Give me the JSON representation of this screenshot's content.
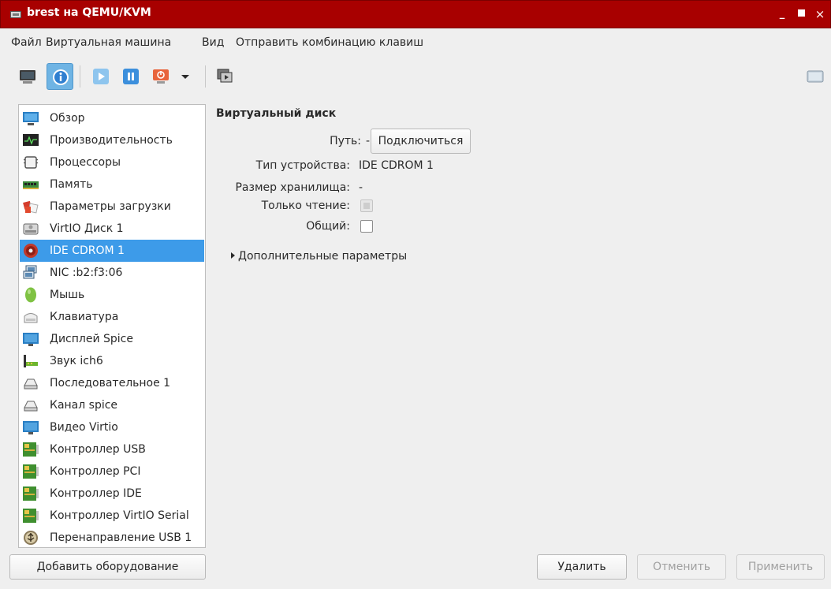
{
  "window": {
    "title": "brest на QEMU/KVM",
    "minimize": "_",
    "close": "×"
  },
  "menu": [
    "Файл",
    "Виртуальная машина",
    "Вид",
    "Отправить комбинацию клавиш"
  ],
  "toolbar": {
    "buttons": [
      "console-icon",
      "info-icon",
      "play-icon",
      "pause-icon",
      "power-icon",
      "dropdown-arrow-icon",
      "snapshot-icon",
      "fullscreen-icon"
    ],
    "active": "info-icon"
  },
  "sidebar": {
    "items": [
      {
        "label": "Обзор",
        "icon": "monitor-icon"
      },
      {
        "label": "Производительность",
        "icon": "performance-icon"
      },
      {
        "label": "Процессоры",
        "icon": "cpu-icon"
      },
      {
        "label": "Память",
        "icon": "memory-icon"
      },
      {
        "label": "Параметры загрузки",
        "icon": "boot-options-icon"
      },
      {
        "label": "VirtIO Диск 1",
        "icon": "disk-icon"
      },
      {
        "label": "IDE CDROM 1",
        "icon": "cdrom-icon"
      },
      {
        "label": "NIC :b2:f3:06",
        "icon": "network-icon"
      },
      {
        "label": "Мышь",
        "icon": "mouse-icon"
      },
      {
        "label": "Клавиатура",
        "icon": "keyboard-icon"
      },
      {
        "label": "Дисплей Spice",
        "icon": "display-icon"
      },
      {
        "label": "Звук ich6",
        "icon": "sound-icon"
      },
      {
        "label": "Последовательное 1",
        "icon": "serial-icon"
      },
      {
        "label": "Канал spice",
        "icon": "channel-icon"
      },
      {
        "label": "Видео Virtio",
        "icon": "video-icon"
      },
      {
        "label": "Контроллер USB",
        "icon": "controller-icon"
      },
      {
        "label": "Контроллер PCI",
        "icon": "controller-icon"
      },
      {
        "label": "Контроллер IDE",
        "icon": "controller-icon"
      },
      {
        "label": "Контроллер VirtIO Serial",
        "icon": "controller-icon"
      },
      {
        "label": "Перенаправление USB 1",
        "icon": "usb-redirect-icon"
      }
    ],
    "selected": "IDE CDROM 1"
  },
  "details": {
    "section_title": "Виртуальный диск",
    "path_label": "Путь:",
    "path_value": "-",
    "connect_button": "Подключиться",
    "device_type_label": "Тип устройства:",
    "device_type_value": "IDE CDROM 1",
    "storage_size_label": "Размер хранилища:",
    "storage_size_value": "-",
    "readonly_label": "Только чтение:",
    "readonly_checked": true,
    "shared_label": "Общий:",
    "shared_checked": false,
    "advanced_expander": "Дополнительные параметры"
  },
  "footer": {
    "add_hardware": "Добавить оборудование",
    "remove": "Удалить",
    "cancel": "Отменить",
    "apply": "Применить"
  },
  "colors": {
    "titlebar": "#a80000",
    "selection": "#3d9be9",
    "active_toolbar": "#6fb4e4"
  }
}
